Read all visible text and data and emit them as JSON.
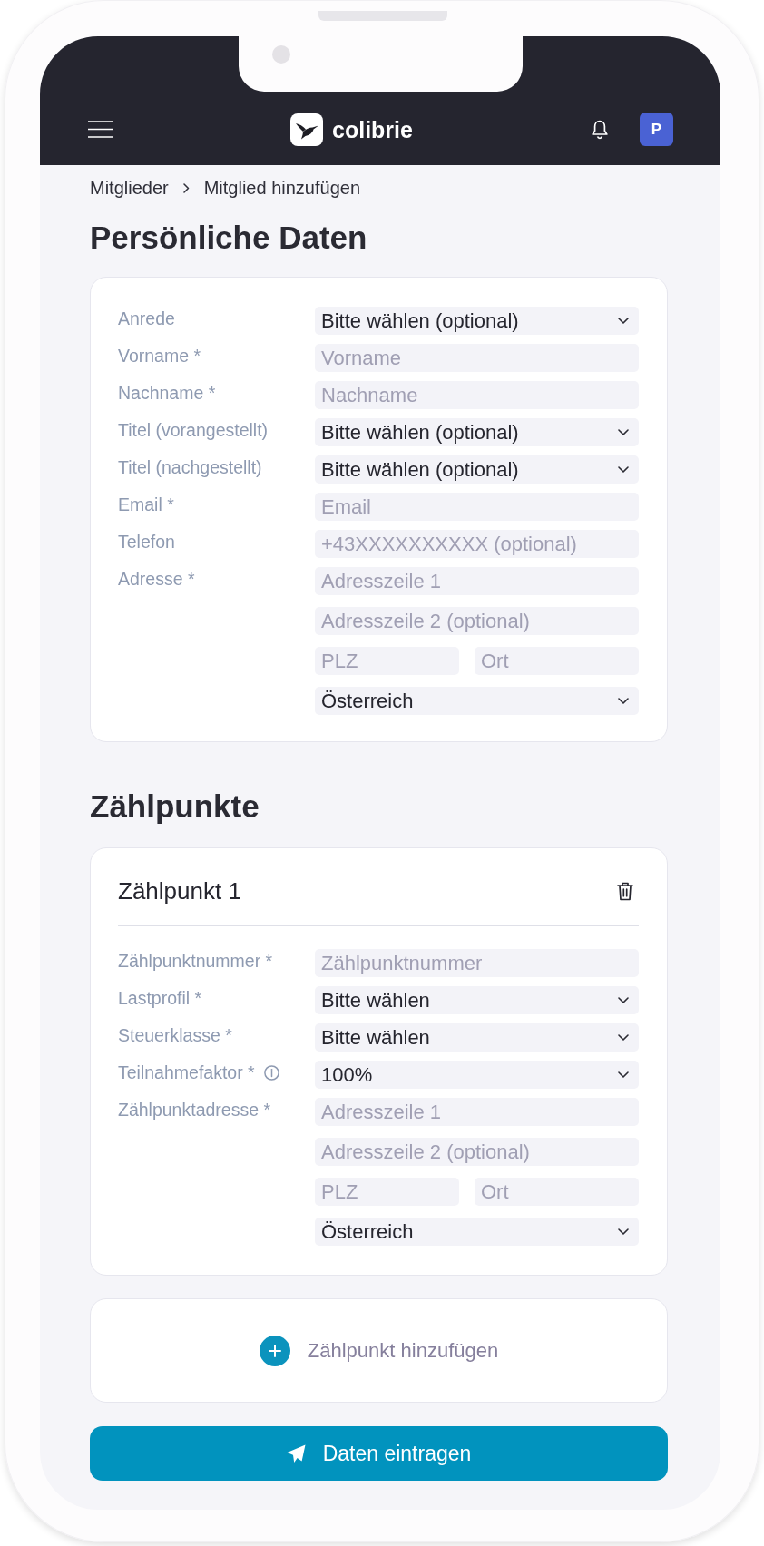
{
  "top_bar": {
    "brand": "colibrie",
    "avatar_initial": "P"
  },
  "breadcrumb": [
    "Mitglieder",
    "Mitglied hinzufügen"
  ],
  "personal": {
    "title": "Persönliche Daten",
    "fields": [
      {
        "label": "Anrede",
        "controls": [
          {
            "kind": "select",
            "value": "Bitte wählen (optional)"
          }
        ]
      },
      {
        "label": "Vorname *",
        "controls": [
          {
            "kind": "input",
            "placeholder": "Vorname"
          }
        ]
      },
      {
        "label": "Nachname *",
        "controls": [
          {
            "kind": "input",
            "placeholder": "Nachname"
          }
        ]
      },
      {
        "label": "Titel (vorangestellt)",
        "controls": [
          {
            "kind": "select",
            "value": "Bitte wählen (optional)"
          }
        ]
      },
      {
        "label": "Titel (nachgestellt)",
        "controls": [
          {
            "kind": "select",
            "value": "Bitte wählen (optional)"
          }
        ]
      },
      {
        "label": "Email *",
        "controls": [
          {
            "kind": "input",
            "placeholder": "Email"
          }
        ]
      },
      {
        "label": "Telefon",
        "controls": [
          {
            "kind": "input",
            "placeholder": "+43XXXXXXXXXX (optional)"
          }
        ]
      },
      {
        "label": "Adresse *",
        "controls": [
          {
            "kind": "input",
            "placeholder": "Adresszeile 1"
          },
          {
            "kind": "input",
            "placeholder": "Adresszeile 2 (optional)"
          },
          {
            "kind": "pair",
            "parts": [
              {
                "placeholder": "PLZ"
              },
              {
                "placeholder": "Ort"
              }
            ]
          },
          {
            "kind": "select",
            "value": "Österreich"
          }
        ]
      }
    ]
  },
  "meters_section": {
    "title": "Zählpunkte",
    "meters": [
      {
        "title": "Zählpunkt 1",
        "fields": [
          {
            "label": "Zählpunktnummer *",
            "info": false,
            "controls": [
              {
                "kind": "input",
                "placeholder": "Zählpunktnummer"
              }
            ]
          },
          {
            "label": "Lastprofil *",
            "info": false,
            "controls": [
              {
                "kind": "select",
                "value": "Bitte wählen"
              }
            ]
          },
          {
            "label": "Steuerklasse *",
            "info": false,
            "controls": [
              {
                "kind": "select",
                "value": "Bitte wählen"
              }
            ]
          },
          {
            "label": "Teilnahmefaktor *",
            "info": true,
            "controls": [
              {
                "kind": "select",
                "value": "100%"
              }
            ]
          },
          {
            "label": "Zählpunktadresse *",
            "info": false,
            "controls": [
              {
                "kind": "input",
                "placeholder": "Adresszeile 1"
              },
              {
                "kind": "input",
                "placeholder": "Adresszeile 2 (optional)"
              },
              {
                "kind": "pair",
                "parts": [
                  {
                    "placeholder": "PLZ"
                  },
                  {
                    "placeholder": "Ort"
                  }
                ]
              },
              {
                "kind": "select",
                "value": "Österreich"
              }
            ]
          }
        ]
      }
    ],
    "add_label": "Zählpunkt hinzufügen"
  },
  "submit_label": "Daten eintragen"
}
